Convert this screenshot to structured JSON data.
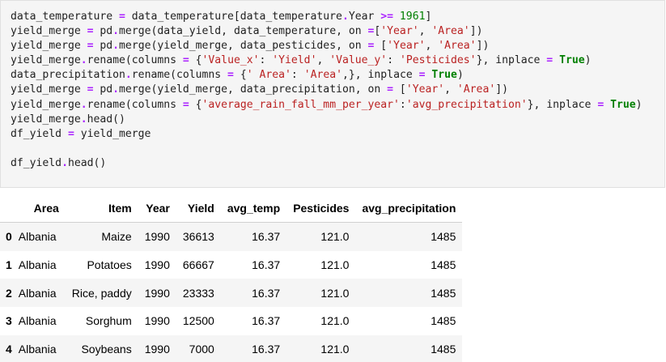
{
  "code_cell": {
    "lines": [
      [
        {
          "t": "data_temperature ",
          "c": ""
        },
        {
          "t": "=",
          "c": "op"
        },
        {
          "t": " data_temperature[data_temperature",
          "c": ""
        },
        {
          "t": ".",
          "c": "op"
        },
        {
          "t": "Year ",
          "c": ""
        },
        {
          "t": ">=",
          "c": "op"
        },
        {
          "t": " ",
          "c": ""
        },
        {
          "t": "1961",
          "c": "num"
        },
        {
          "t": "]",
          "c": ""
        }
      ],
      [
        {
          "t": "yield_merge ",
          "c": ""
        },
        {
          "t": "=",
          "c": "op"
        },
        {
          "t": " pd",
          "c": ""
        },
        {
          "t": ".",
          "c": "op"
        },
        {
          "t": "merge(data_yield, data_temperature, on ",
          "c": ""
        },
        {
          "t": "=",
          "c": "op"
        },
        {
          "t": "[",
          "c": ""
        },
        {
          "t": "'Year'",
          "c": "str"
        },
        {
          "t": ", ",
          "c": ""
        },
        {
          "t": "'Area'",
          "c": "str"
        },
        {
          "t": "])",
          "c": ""
        }
      ],
      [
        {
          "t": "yield_merge ",
          "c": ""
        },
        {
          "t": "=",
          "c": "op"
        },
        {
          "t": " pd",
          "c": ""
        },
        {
          "t": ".",
          "c": "op"
        },
        {
          "t": "merge(yield_merge, data_pesticides, on ",
          "c": ""
        },
        {
          "t": "=",
          "c": "op"
        },
        {
          "t": " [",
          "c": ""
        },
        {
          "t": "'Year'",
          "c": "str"
        },
        {
          "t": ", ",
          "c": ""
        },
        {
          "t": "'Area'",
          "c": "str"
        },
        {
          "t": "])",
          "c": ""
        }
      ],
      [
        {
          "t": "yield_merge",
          "c": ""
        },
        {
          "t": ".",
          "c": "op"
        },
        {
          "t": "rename(columns ",
          "c": ""
        },
        {
          "t": "=",
          "c": "op"
        },
        {
          "t": " {",
          "c": ""
        },
        {
          "t": "'Value_x'",
          "c": "str"
        },
        {
          "t": ": ",
          "c": ""
        },
        {
          "t": "'Yield'",
          "c": "str"
        },
        {
          "t": ", ",
          "c": ""
        },
        {
          "t": "'Value_y'",
          "c": "str"
        },
        {
          "t": ": ",
          "c": ""
        },
        {
          "t": "'Pesticides'",
          "c": "str"
        },
        {
          "t": "}, inplace ",
          "c": ""
        },
        {
          "t": "=",
          "c": "op"
        },
        {
          "t": " ",
          "c": ""
        },
        {
          "t": "True",
          "c": "kw"
        },
        {
          "t": ")",
          "c": ""
        }
      ],
      [
        {
          "t": "data_precipitation",
          "c": ""
        },
        {
          "t": ".",
          "c": "op"
        },
        {
          "t": "rename(columns ",
          "c": ""
        },
        {
          "t": "=",
          "c": "op"
        },
        {
          "t": " {",
          "c": ""
        },
        {
          "t": "' Area'",
          "c": "str"
        },
        {
          "t": ": ",
          "c": ""
        },
        {
          "t": "'Area'",
          "c": "str"
        },
        {
          "t": ",}, inplace ",
          "c": ""
        },
        {
          "t": "=",
          "c": "op"
        },
        {
          "t": " ",
          "c": ""
        },
        {
          "t": "True",
          "c": "kw"
        },
        {
          "t": ")",
          "c": ""
        }
      ],
      [
        {
          "t": "yield_merge ",
          "c": ""
        },
        {
          "t": "=",
          "c": "op"
        },
        {
          "t": " pd",
          "c": ""
        },
        {
          "t": ".",
          "c": "op"
        },
        {
          "t": "merge(yield_merge, data_precipitation, on ",
          "c": ""
        },
        {
          "t": "=",
          "c": "op"
        },
        {
          "t": " [",
          "c": ""
        },
        {
          "t": "'Year'",
          "c": "str"
        },
        {
          "t": ", ",
          "c": ""
        },
        {
          "t": "'Area'",
          "c": "str"
        },
        {
          "t": "])",
          "c": ""
        }
      ],
      [
        {
          "t": "yield_merge",
          "c": ""
        },
        {
          "t": ".",
          "c": "op"
        },
        {
          "t": "rename(columns ",
          "c": ""
        },
        {
          "t": "=",
          "c": "op"
        },
        {
          "t": " {",
          "c": ""
        },
        {
          "t": "'average_rain_fall_mm_per_year'",
          "c": "str"
        },
        {
          "t": ":",
          "c": ""
        },
        {
          "t": "'avg_precipitation'",
          "c": "str"
        },
        {
          "t": "}, inplace ",
          "c": ""
        },
        {
          "t": "=",
          "c": "op"
        },
        {
          "t": " ",
          "c": ""
        },
        {
          "t": "True",
          "c": "kw"
        },
        {
          "t": ")",
          "c": ""
        }
      ],
      [
        {
          "t": "yield_merge",
          "c": ""
        },
        {
          "t": ".",
          "c": "op"
        },
        {
          "t": "head()",
          "c": ""
        }
      ],
      [
        {
          "t": "df_yield ",
          "c": ""
        },
        {
          "t": "=",
          "c": "op"
        },
        {
          "t": " yield_merge",
          "c": ""
        }
      ],
      [],
      [
        {
          "t": "df_yield",
          "c": ""
        },
        {
          "t": ".",
          "c": "op"
        },
        {
          "t": "head()",
          "c": ""
        }
      ]
    ]
  },
  "output_table": {
    "columns": [
      "Area",
      "Item",
      "Year",
      "Yield",
      "avg_temp",
      "Pesticides",
      "avg_precipitation"
    ],
    "rows": [
      {
        "index": "0",
        "cells": [
          "Albania",
          "Maize",
          "1990",
          "36613",
          "16.37",
          "121.0",
          "1485"
        ]
      },
      {
        "index": "1",
        "cells": [
          "Albania",
          "Potatoes",
          "1990",
          "66667",
          "16.37",
          "121.0",
          "1485"
        ]
      },
      {
        "index": "2",
        "cells": [
          "Albania",
          "Rice, paddy",
          "1990",
          "23333",
          "16.37",
          "121.0",
          "1485"
        ]
      },
      {
        "index": "3",
        "cells": [
          "Albania",
          "Sorghum",
          "1990",
          "12500",
          "16.37",
          "121.0",
          "1485"
        ]
      },
      {
        "index": "4",
        "cells": [
          "Albania",
          "Soybeans",
          "1990",
          "7000",
          "16.37",
          "121.0",
          "1485"
        ]
      }
    ]
  }
}
